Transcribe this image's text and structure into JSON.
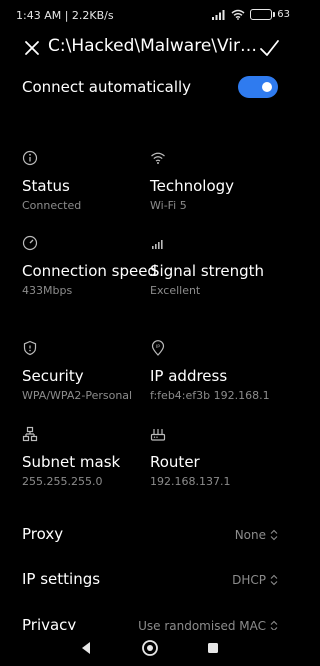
{
  "status_bar": {
    "time_speed": "1:43 AM | 2.2KB/s",
    "battery": "63",
    "battery_level": 0.63,
    "icons": [
      "signal-icon",
      "wifi-icon",
      "battery-icon"
    ]
  },
  "header": {
    "title": "C:\\Hacked\\Malware\\Virus",
    "close_icon": "close-icon",
    "confirm_icon": "check-icon"
  },
  "auto_connect": {
    "label": "Connect automatically",
    "enabled": true,
    "accent": "#2f7bef"
  },
  "details": [
    {
      "label": "Status",
      "value": "Connected",
      "icon": "info-icon"
    },
    {
      "label": "Technology",
      "value": "Wi-Fi 5",
      "icon": "wifi-icon"
    },
    {
      "label": "Connection speed",
      "value": "433Mbps",
      "icon": "speedometer-icon"
    },
    {
      "label": "Signal strength",
      "value": "Excellent",
      "icon": "signal-bars-icon"
    },
    {
      "label": "Security",
      "value": "WPA/WPA2-Personal",
      "icon": "shield-icon"
    },
    {
      "label": "IP address",
      "value": "f:feb4:ef3b 192.168.1",
      "icon": "ip-pin-icon"
    },
    {
      "label": "Subnet mask",
      "value": "255.255.255.0",
      "icon": "network-icon"
    },
    {
      "label": "Router",
      "value": "192.168.137.1",
      "icon": "router-icon"
    }
  ],
  "prefs": [
    {
      "label": "Proxy",
      "value": "None"
    },
    {
      "label": "IP settings",
      "value": "DHCP"
    },
    {
      "label": "Privacy",
      "value": "Use randomised MAC"
    }
  ],
  "navbar": {
    "icons": [
      "back-icon",
      "home-icon",
      "recents-icon"
    ]
  }
}
